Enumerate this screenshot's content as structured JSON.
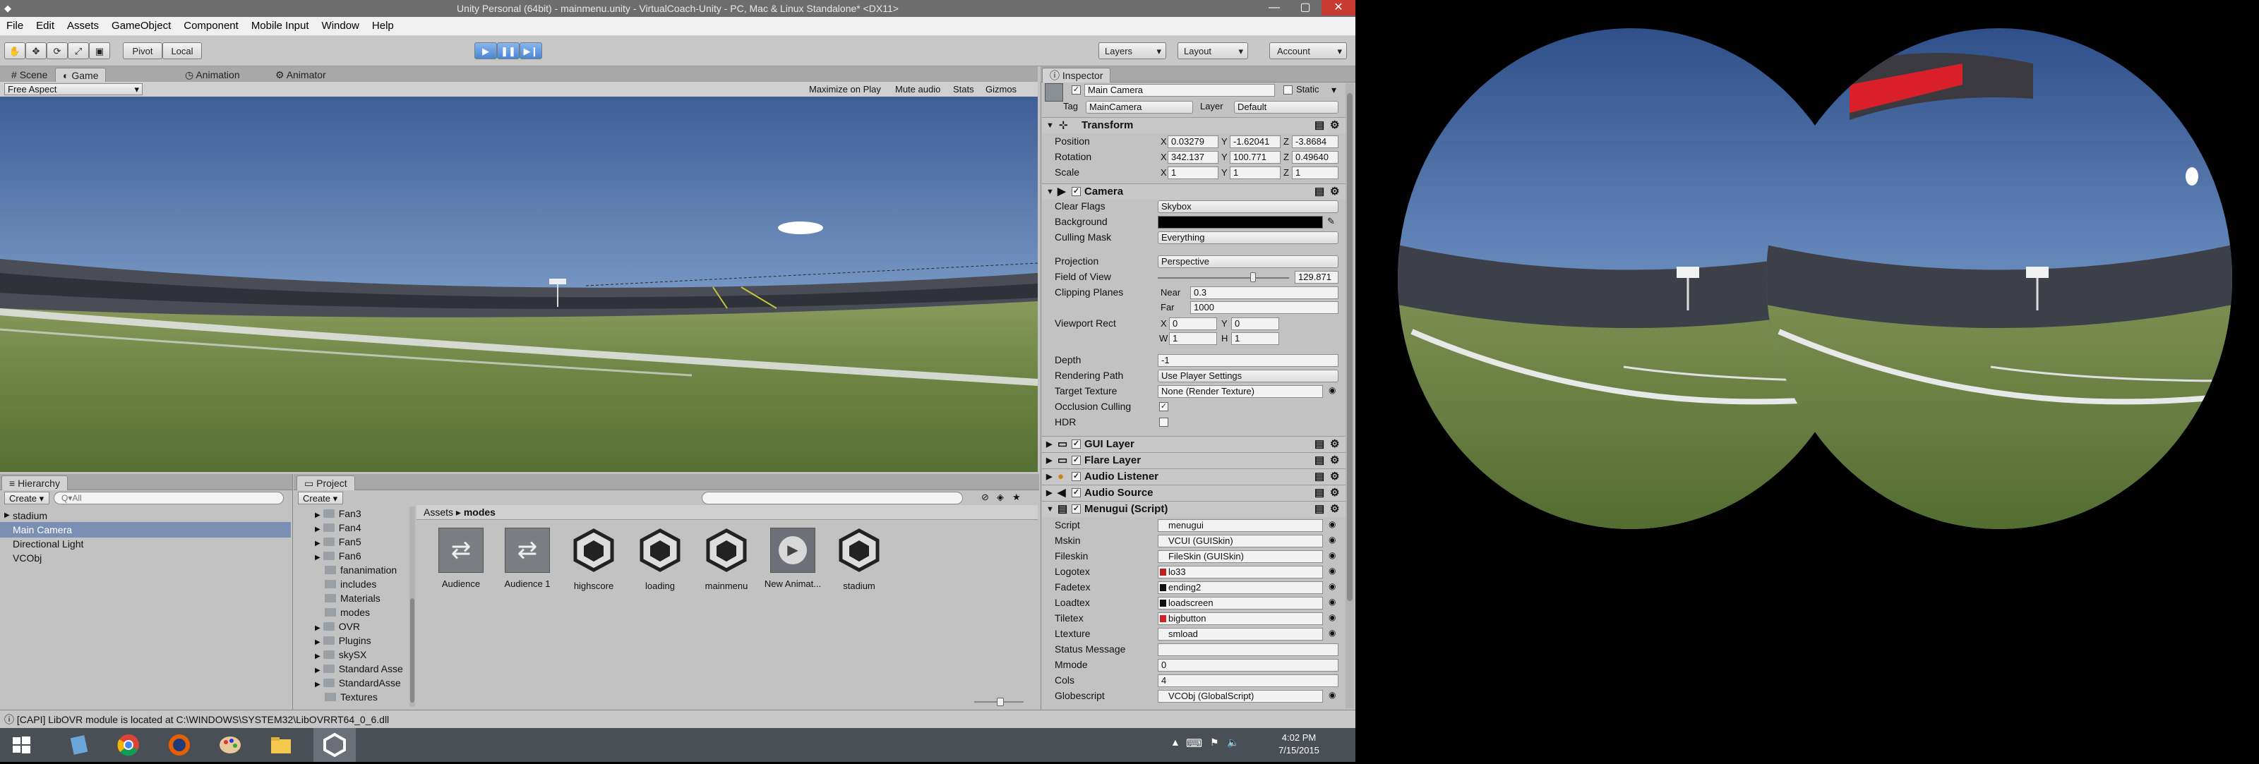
{
  "window": {
    "title": "Unity Personal (64bit) - mainmenu.unity - VirtualCoach-Unity - PC, Mac & Linux Standalone* <DX11>",
    "minimize": "—",
    "maximize": "▢",
    "close": "✕"
  },
  "menu": [
    "File",
    "Edit",
    "Assets",
    "GameObject",
    "Component",
    "Mobile Input",
    "Window",
    "Help"
  ],
  "toolbar": {
    "pivot": "Pivot",
    "local": "Local",
    "layers": "Layers",
    "layout": "Layout",
    "account": "Account"
  },
  "view_tabs": [
    "Scene",
    "Game",
    "Animation",
    "Animator"
  ],
  "game_bar": {
    "aspect": "Free Aspect",
    "buttons": [
      "Maximize on Play",
      "Mute audio",
      "Stats",
      "Gizmos"
    ]
  },
  "inspector": {
    "tab": "Inspector",
    "object_name": "Main Camera",
    "static_label": "Static",
    "tag_label": "Tag",
    "tag_value": "MainCamera",
    "layer_label": "Layer",
    "layer_value": "Default",
    "transform": {
      "title": "Transform",
      "position": {
        "label": "Position",
        "x": "0.03279",
        "y": "-1.62041",
        "z": "-3.8684"
      },
      "rotation": {
        "label": "Rotation",
        "x": "342.137",
        "y": "100.771",
        "z": "0.49640"
      },
      "scale": {
        "label": "Scale",
        "x": "1",
        "y": "1",
        "z": "1"
      }
    },
    "camera": {
      "title": "Camera",
      "clear_flags": {
        "label": "Clear Flags",
        "value": "Skybox"
      },
      "background": {
        "label": "Background"
      },
      "culling_mask": {
        "label": "Culling Mask",
        "value": "Everything"
      },
      "projection": {
        "label": "Projection",
        "value": "Perspective"
      },
      "fov": {
        "label": "Field of View",
        "value": "129.871",
        "fraction": 0.72
      },
      "clipping": {
        "label": "Clipping Planes",
        "near_label": "Near",
        "near": "0.3",
        "far_label": "Far",
        "far": "1000"
      },
      "viewport": {
        "label": "Viewport Rect",
        "x": "0",
        "y": "0",
        "w": "1",
        "h": "1"
      },
      "depth": {
        "label": "Depth",
        "value": "-1"
      },
      "rendering_path": {
        "label": "Rendering Path",
        "value": "Use Player Settings"
      },
      "target_texture": {
        "label": "Target Texture",
        "value": "None (Render Texture)"
      },
      "occlusion": {
        "label": "Occlusion Culling"
      },
      "hdr": {
        "label": "HDR"
      }
    },
    "components": [
      "GUI Layer",
      "Flare Layer",
      "Audio Listener",
      "Audio Source",
      "Menugui (Script)"
    ],
    "menugui": [
      {
        "label": "Script",
        "value": "menugui"
      },
      {
        "label": "Mskin",
        "value": "VCUI (GUISkin)"
      },
      {
        "label": "Fileskin",
        "value": "FileSkin (GUISkin)"
      },
      {
        "label": "Logotex",
        "value": "lo33"
      },
      {
        "label": "Fadetex",
        "value": "ending2"
      },
      {
        "label": "Loadtex",
        "value": "loadscreen"
      },
      {
        "label": "Tiletex",
        "value": "bigbutton"
      },
      {
        "label": "Ltexture",
        "value": "smload"
      },
      {
        "label": "Status Message",
        "value": ""
      },
      {
        "label": "Mmode",
        "value": "0"
      },
      {
        "label": "Cols",
        "value": "4"
      },
      {
        "label": "Globescript",
        "value": "VCObj (GlobalScript)"
      }
    ]
  },
  "hierarchy": {
    "tab": "Hierarchy",
    "create": "Create ▾",
    "search_placeholder": "Q▾All",
    "items": [
      "stadium",
      "Main Camera",
      "Directional Light",
      "VCObj"
    ]
  },
  "project": {
    "tab": "Project",
    "create": "Create ▾",
    "folders": [
      "Fan3",
      "Fan4",
      "Fan5",
      "Fan6",
      "fananimation",
      "includes",
      "Materials",
      "modes",
      "OVR",
      "Plugins",
      "skySX",
      "Standard Asse",
      "StandardAsse",
      "Textures"
    ],
    "breadcrumb_root": "Assets",
    "breadcrumb_sep": "▸",
    "breadcrumb_leaf": "modes",
    "assets": [
      "Audience",
      "Audience 1",
      "highscore",
      "loading",
      "mainmenu",
      "New Animat...",
      "stadium"
    ]
  },
  "console": {
    "message": "[CAPI] LibOVR module is located at C:\\WINDOWS\\SYSTEM32\\LibOVRRT64_0_6.dll"
  },
  "taskbar": {
    "time": "4:02 PM",
    "date": "7/15/2015"
  },
  "colors": {
    "accent": "#4a86d6",
    "selection": "#7a8fb3",
    "tiletex": "#d0202a"
  }
}
